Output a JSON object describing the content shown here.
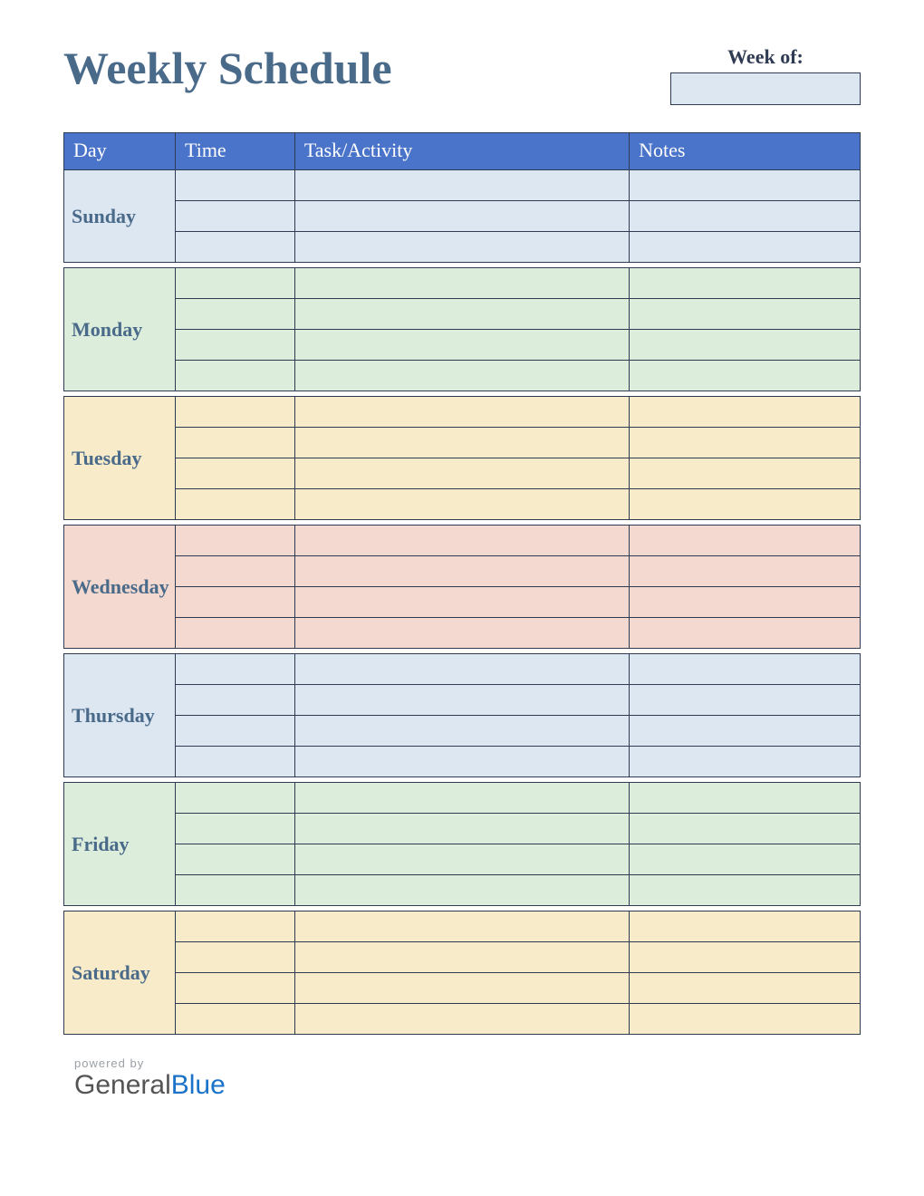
{
  "header": {
    "title": "Weekly Schedule",
    "week_of_label": "Week of:",
    "week_of_value": ""
  },
  "columns": {
    "day": "Day",
    "time": "Time",
    "task": "Task/Activity",
    "notes": "Notes"
  },
  "days": [
    {
      "name": "Sunday",
      "color": "#dde7f2",
      "rows": 3
    },
    {
      "name": "Monday",
      "color": "#dceddb",
      "rows": 4
    },
    {
      "name": "Tuesday",
      "color": "#f7ebc9",
      "rows": 4
    },
    {
      "name": "Wednesday",
      "color": "#f3d9cf",
      "rows": 4
    },
    {
      "name": "Thursday",
      "color": "#dde7f2",
      "rows": 4
    },
    {
      "name": "Friday",
      "color": "#dceddb",
      "rows": 4
    },
    {
      "name": "Saturday",
      "color": "#f7ebc9",
      "rows": 4
    }
  ],
  "footer": {
    "powered_by": "powered by",
    "brand_part1": "General",
    "brand_part2": "Blue"
  }
}
